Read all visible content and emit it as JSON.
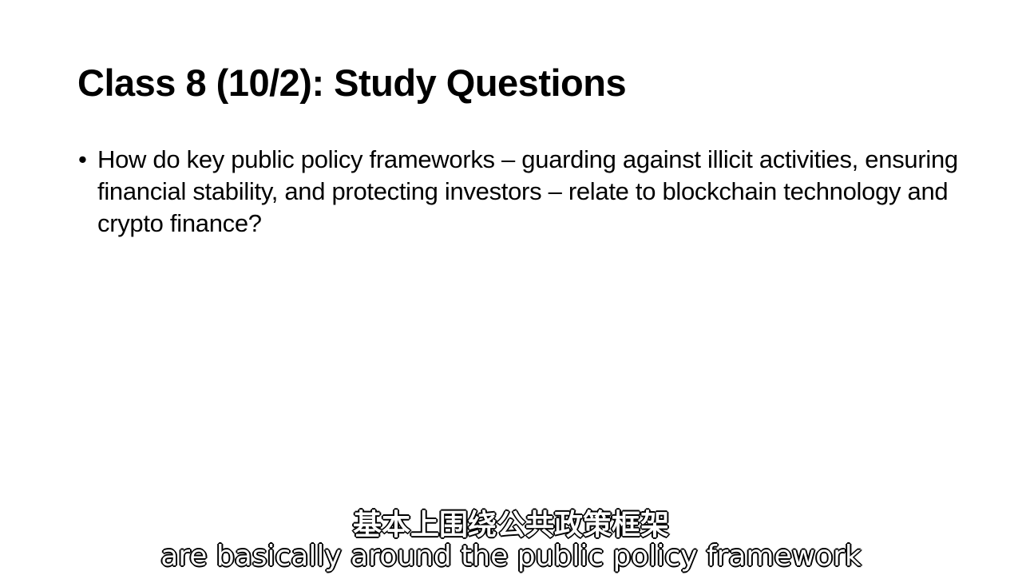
{
  "slide": {
    "title": "Class 8 (10/2): Study Questions",
    "bullets": [
      {
        "marker": "•",
        "text": "How do key public policy frameworks – guarding against illicit activities, ensuring financial stability, and protecting investors – relate to blockchain technology and crypto finance?"
      }
    ]
  },
  "subtitles": {
    "chinese": "基本上围绕公共政策框架",
    "english": "are basically around the public policy framework"
  }
}
